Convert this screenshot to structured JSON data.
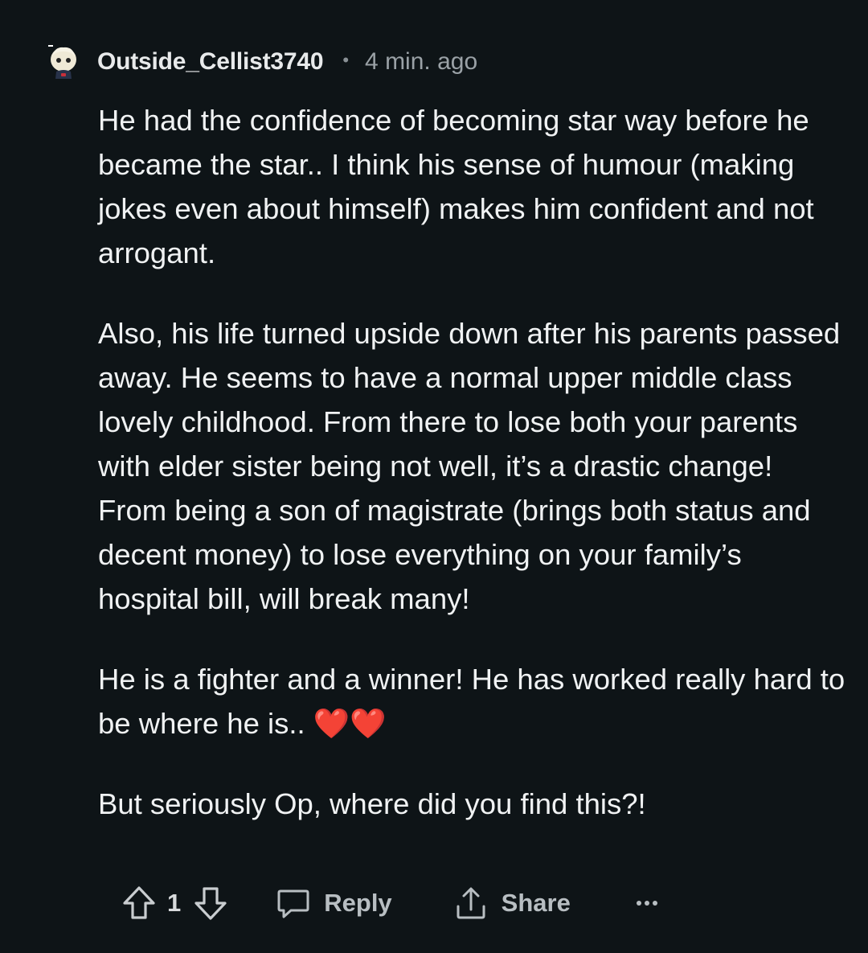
{
  "comment": {
    "author": "Outside_Cellist3740",
    "separator": "•",
    "time": "4 min. ago",
    "paragraphs": [
      "He had the confidence of becoming star way before he became the star.. I think his sense of humour (making jokes even about himself) makes him confident and not arrogant.",
      "Also, his life turned upside down after his parents passed away. He seems to have a normal upper middle class lovely childhood. From there to lose both your parents with elder sister being not well, it’s a drastic change! From being a son of magistrate (brings both status and decent money) to lose everything on your family’s hospital bill, will break many!",
      "He is a fighter and a winner! He has worked really hard to be where he is.. ❤️❤️",
      "But seriously Op, where did you find this?!"
    ]
  },
  "actions": {
    "vote_count": "1",
    "reply_label": "Reply",
    "share_label": "Share"
  },
  "icons": {
    "upvote": "upvote-arrow-icon",
    "downvote": "downvote-arrow-icon",
    "reply": "speech-bubble-icon",
    "share": "share-upload-icon",
    "more": "more-dots-icon",
    "avatar": "snoo-avatar-icon"
  },
  "colors": {
    "background": "#0e1417",
    "text": "#f0f2f3",
    "muted": "#9aa1a6",
    "action": "#b8bec2"
  }
}
